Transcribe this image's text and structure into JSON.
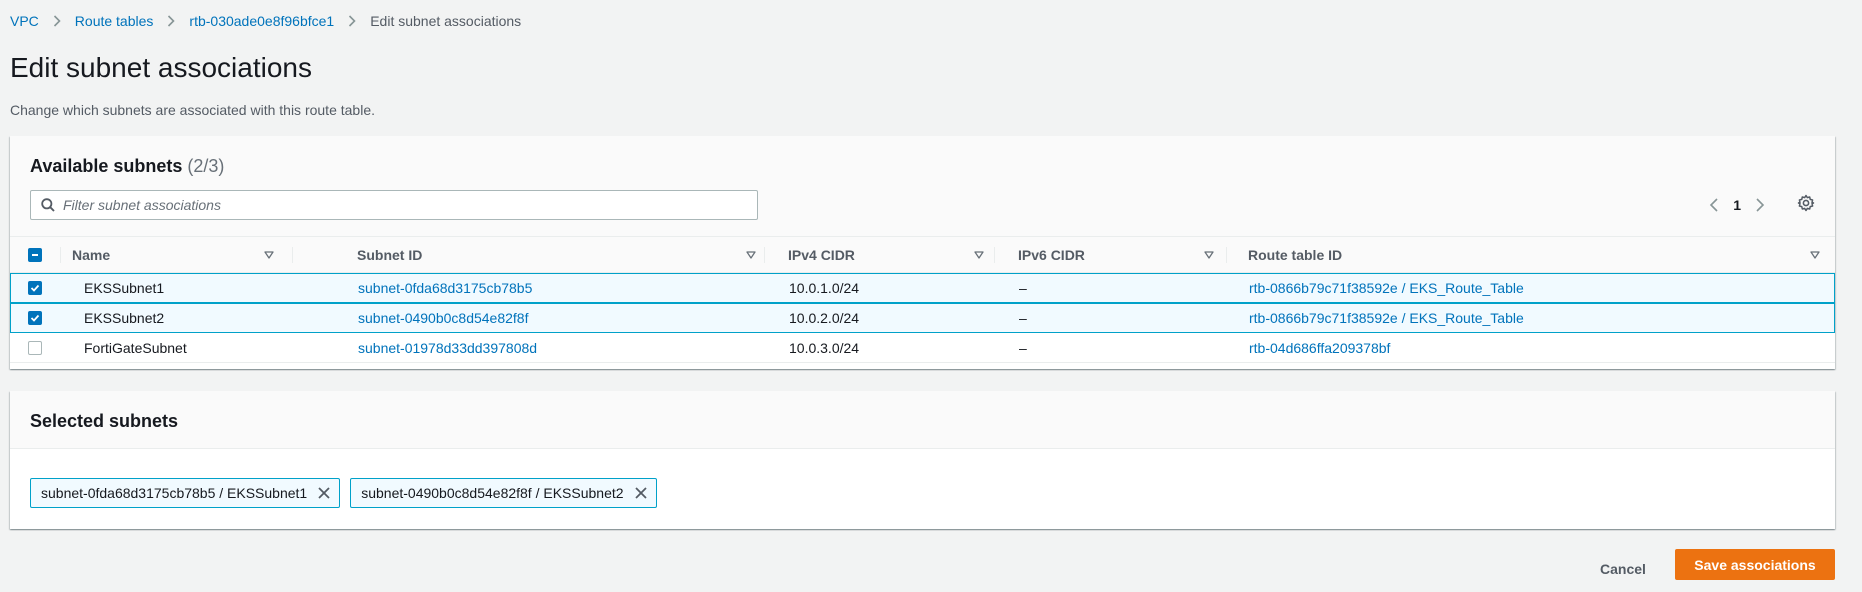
{
  "breadcrumb": {
    "items": [
      "VPC",
      "Route tables",
      "rtb-030ade0e8f96bfce1"
    ],
    "current": "Edit subnet associations"
  },
  "page": {
    "title": "Edit subnet associations",
    "description": "Change which subnets are associated with this route table."
  },
  "available": {
    "title": "Available subnets",
    "count": "(2/3)",
    "filter_placeholder": "Filter subnet associations",
    "filter_value": "",
    "page_number": "1",
    "columns": [
      "Name",
      "Subnet ID",
      "IPv4 CIDR",
      "IPv6 CIDR",
      "Route table ID"
    ],
    "rows": [
      {
        "checked": true,
        "name": "EKSSubnet1",
        "subnet_id": "subnet-0fda68d3175cb78b5",
        "ipv4": "10.0.1.0/24",
        "ipv6": "–",
        "route_table": "rtb-0866b79c71f38592e / EKS_Route_Table"
      },
      {
        "checked": true,
        "name": "EKSSubnet2",
        "subnet_id": "subnet-0490b0c8d54e82f8f",
        "ipv4": "10.0.2.0/24",
        "ipv6": "–",
        "route_table": "rtb-0866b79c71f38592e / EKS_Route_Table"
      },
      {
        "checked": false,
        "name": "FortiGateSubnet",
        "subnet_id": "subnet-01978d33dd397808d",
        "ipv4": "10.0.3.0/24",
        "ipv6": "–",
        "route_table": "rtb-04d686ffa209378bf"
      }
    ]
  },
  "selected": {
    "title": "Selected subnets",
    "tokens": [
      "subnet-0fda68d3175cb78b5 / EKSSubnet1",
      "subnet-0490b0c8d54e82f8f / EKSSubnet2"
    ]
  },
  "actions": {
    "cancel_label": "Cancel",
    "save_label": "Save associations"
  },
  "icons": {
    "breadcrumb_separator": "chevron-right-icon",
    "search": "search-icon",
    "prev_page": "chevron-left-icon",
    "next_page": "chevron-right-icon",
    "settings": "gear-icon",
    "sort": "sort-caret-icon",
    "remove_token": "close-icon"
  },
  "colors": {
    "link": "#0073bb",
    "primary_button": "#ec7211",
    "selected_row_border": "#00a1c9",
    "selected_row_bg": "#f1faff",
    "checkbox_checked": "#0073bb"
  }
}
